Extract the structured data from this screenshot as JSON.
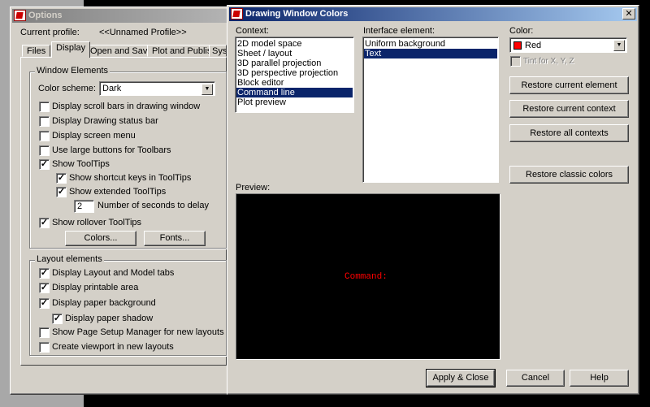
{
  "options": {
    "title": "Options",
    "current_profile_label": "Current profile:",
    "current_profile_value": "<<Unnamed Profile>>",
    "tabs": [
      "Files",
      "Display",
      "Open and Save",
      "Plot and Publish",
      "Sys"
    ],
    "active_tab": "Display",
    "window_elements": {
      "label": "Window Elements",
      "color_scheme_label": "Color scheme:",
      "color_scheme_value": "Dark",
      "items": [
        {
          "label": "Display scroll bars in drawing window",
          "checked": false
        },
        {
          "label": "Display Drawing status bar",
          "checked": false
        },
        {
          "label": "Display screen menu",
          "checked": false
        },
        {
          "label": "Use large buttons for Toolbars",
          "checked": false
        },
        {
          "label": "Show ToolTips",
          "checked": true
        },
        {
          "label": "Show shortcut keys in ToolTips",
          "checked": true
        },
        {
          "label": "Show extended ToolTips",
          "checked": true
        },
        {
          "label": "Show rollover ToolTips",
          "checked": true
        }
      ],
      "delay_value": "2",
      "delay_label": "Number of seconds to delay",
      "colors_button": "Colors...",
      "fonts_button": "Fonts..."
    },
    "layout_elements": {
      "label": "Layout elements",
      "items": [
        {
          "label": "Display Layout and Model tabs",
          "checked": true
        },
        {
          "label": "Display printable area",
          "checked": true
        },
        {
          "label": "Display paper background",
          "checked": true
        },
        {
          "label": "Display paper shadow",
          "checked": true
        },
        {
          "label": "Show Page Setup Manager for new layouts",
          "checked": false
        },
        {
          "label": "Create viewport in new layouts",
          "checked": false
        }
      ]
    }
  },
  "colors_dialog": {
    "title": "Drawing Window Colors",
    "close_glyph": "✕",
    "context_label": "Context:",
    "contexts": [
      "2D model space",
      "Sheet / layout",
      "3D parallel projection",
      "3D perspective projection",
      "Block editor",
      "Command line",
      "Plot preview"
    ],
    "selected_context": "Command line",
    "interface_label": "Interface element:",
    "interface_elements": [
      "Uniform background",
      "Text"
    ],
    "selected_interface": "Text",
    "color_label": "Color:",
    "color_value": "Red",
    "color_swatch": "#ff0000",
    "tint_label": "Tint for X, Y, Z",
    "restore_element": "Restore current element",
    "restore_context": "Restore current context",
    "restore_all": "Restore all contexts",
    "restore_classic": "Restore classic colors",
    "preview_label": "Preview:",
    "preview_text": "Command:",
    "apply_close": "Apply & Close",
    "cancel": "Cancel",
    "help": "Help"
  }
}
